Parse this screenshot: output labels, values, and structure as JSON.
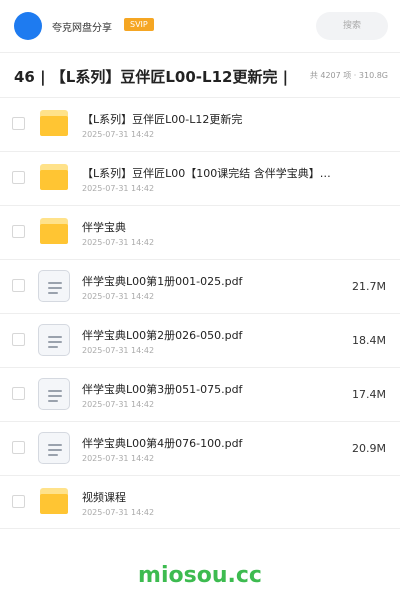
{
  "header": {
    "brand": "夸克网盘分享",
    "badge": "SVIP",
    "search_label": "搜索"
  },
  "title_bar": {
    "title": "46 | 【L系列】豆伴匠L00-L12更新完 |",
    "stats": "共 4207 项 · 310.8G"
  },
  "files": [
    {
      "type": "folder",
      "name": "【L系列】豆伴匠L00-L12更新完",
      "date": "2025-07-31 14:42",
      "size": ""
    },
    {
      "type": "folder",
      "name": "【L系列】豆伴匠L00【100课完结 含伴学宝典】…",
      "date": "2025-07-31 14:42",
      "size": ""
    },
    {
      "type": "folder",
      "name": "伴学宝典",
      "date": "2025-07-31 14:42",
      "size": ""
    },
    {
      "type": "file",
      "name": "伴学宝典L00第1册001-025.pdf",
      "date": "2025-07-31 14:42",
      "size": "21.7M"
    },
    {
      "type": "file",
      "name": "伴学宝典L00第2册026-050.pdf",
      "date": "2025-07-31 14:42",
      "size": "18.4M"
    },
    {
      "type": "file",
      "name": "伴学宝典L00第3册051-075.pdf",
      "date": "2025-07-31 14:42",
      "size": "17.4M"
    },
    {
      "type": "file",
      "name": "伴学宝典L00第4册076-100.pdf",
      "date": "2025-07-31 14:42",
      "size": "20.9M"
    },
    {
      "type": "folder",
      "name": "视频课程",
      "date": "2025-07-31 14:42",
      "size": ""
    }
  ],
  "watermark": "miosou.cc",
  "colors": {
    "avatar": "#1e7bf0",
    "badge": "#f5a623",
    "folder": "#ffc533",
    "watermark": "#3dbb50"
  }
}
